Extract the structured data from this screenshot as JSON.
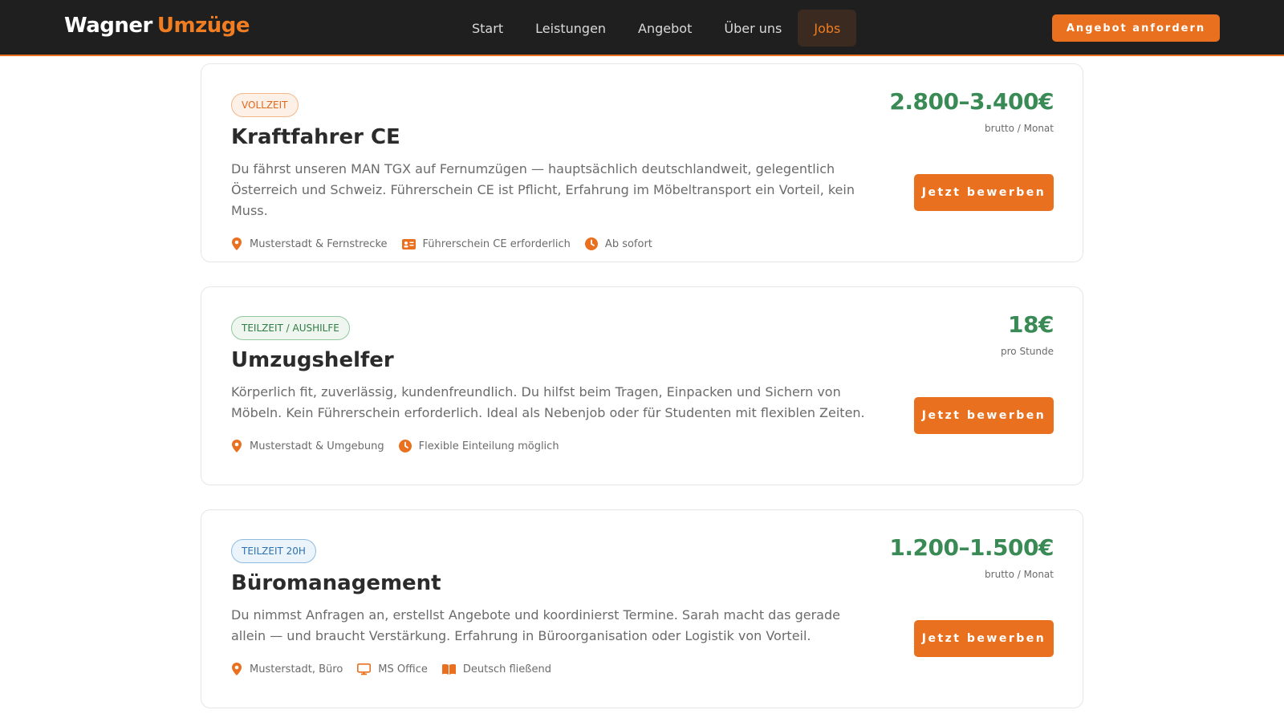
{
  "brand": {
    "name_part1": "Wagner",
    "name_part2": "Umzüge"
  },
  "nav": {
    "items": [
      {
        "label": "Start"
      },
      {
        "label": "Leistungen"
      },
      {
        "label": "Angebot"
      },
      {
        "label": "Über uns"
      },
      {
        "label": "Jobs",
        "active": true
      }
    ],
    "cta_label": "Angebot anfordern"
  },
  "jobs": [
    {
      "badge": "VOLLZEIT",
      "title": "Kraftfahrer CE",
      "description": "Du fährst unseren MAN TGX auf Fernumzügen — hauptsächlich deutschlandweit, gelegentlich Österreich und Schweiz. Führerschein CE ist Pflicht, Erfahrung im Möbeltransport ein Vorteil, kein Muss.",
      "meta": [
        {
          "icon": "location-pin-icon",
          "text": "Musterstadt & Fernstrecke"
        },
        {
          "icon": "id-card-icon",
          "text": "Führerschein CE erforderlich"
        },
        {
          "icon": "clock-icon",
          "text": "Ab sofort"
        }
      ],
      "salary": "2.800–3.400€",
      "salary_unit": "brutto / Monat",
      "apply_label": "Jetzt bewerben"
    },
    {
      "badge": "TEILZEIT / AUSHILFE",
      "title": "Umzugshelfer",
      "description": "Körperlich fit, zuverlässig, kundenfreundlich. Du hilfst beim Tragen, Einpacken und Sichern von Möbeln. Kein Führerschein erforderlich. Ideal als Nebenjob oder für Studenten mit flexiblen Zeiten.",
      "meta": [
        {
          "icon": "location-pin-icon",
          "text": "Musterstadt & Umgebung"
        },
        {
          "icon": "clock-icon",
          "text": "Flexible Einteilung möglich"
        }
      ],
      "salary": "18€",
      "salary_unit": "pro Stunde",
      "apply_label": "Jetzt bewerben"
    },
    {
      "badge": "TEILZEIT 20H",
      "title": "Büromanagement",
      "description": "Du nimmst Anfragen an, erstellst Angebote und koordinierst Termine. Sarah macht das gerade allein — und braucht Verstärkung. Erfahrung in Büroorganisation oder Logistik von Vorteil.",
      "meta": [
        {
          "icon": "location-pin-icon",
          "text": "Musterstadt, Büro"
        },
        {
          "icon": "monitor-icon",
          "text": "MS Office"
        },
        {
          "icon": "book-icon",
          "text": "Deutsch fließend"
        }
      ],
      "salary": "1.200–1.500€",
      "salary_unit": "brutto / Monat",
      "apply_label": "Jetzt bewerben"
    }
  ],
  "colors": {
    "accent": "#e8701f",
    "header_bg": "#1f1f1f",
    "salary_green": "#3a8a55"
  }
}
